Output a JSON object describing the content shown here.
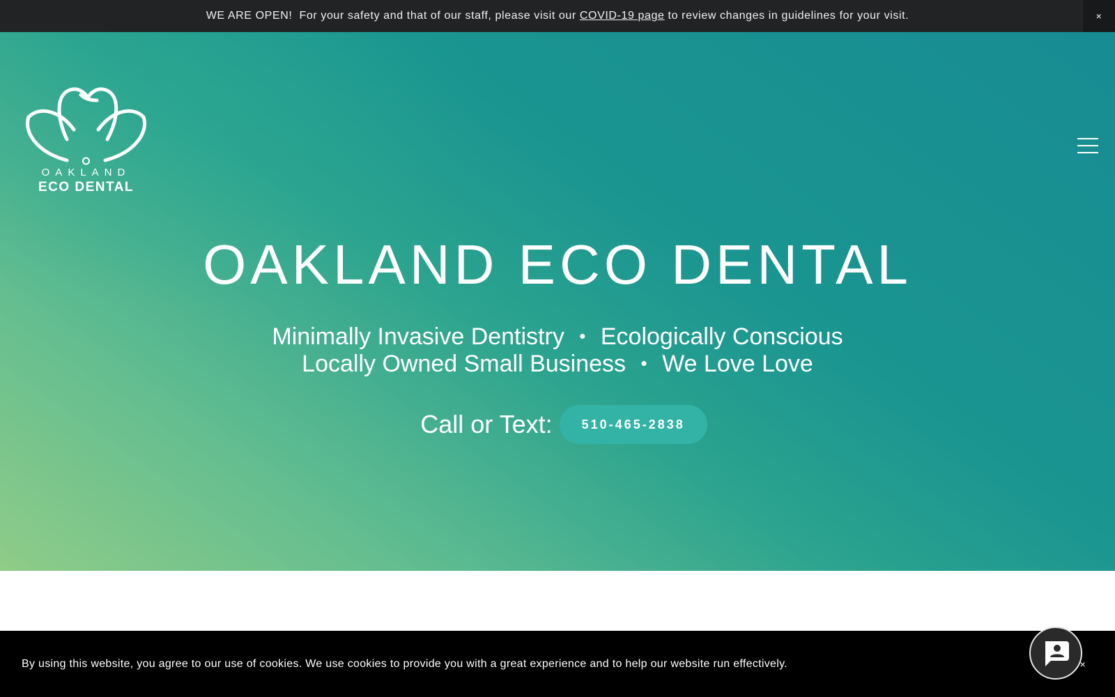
{
  "announcement": {
    "text_before": "WE ARE OPEN!  For your safety and that of our staff, please visit our ",
    "link_text": "COVID-19 page",
    "text_after": " to review changes in guidelines for your visit.",
    "close_label": "×"
  },
  "logo": {
    "line1": "OAKLAND",
    "line2": "ECO DENTAL",
    "icon": "tooth-flower-logo-icon"
  },
  "nav": {
    "menu_icon": "hamburger-menu-icon"
  },
  "hero": {
    "title": "OAKLAND ECO DENTAL",
    "taglines": [
      [
        "Minimally Invasive Dentistry",
        "Ecologically Conscious"
      ],
      [
        "Locally Owned Small Business",
        "We Love Love"
      ]
    ],
    "separator": "•",
    "call_label": "Call or Text:",
    "phone": "510-465-2838"
  },
  "cookie": {
    "text": "By using this website, you agree to our use of cookies. We use cookies to provide you with a great experience and to help our website run effectively.",
    "close_label": "×"
  },
  "chat": {
    "icon": "chat-person-icon"
  },
  "colors": {
    "announce_bg": "#222324",
    "hero_gradient_start": "#8fcc88",
    "hero_gradient_end": "#178c93",
    "phone_button": "#33b3a5",
    "cookie_bg": "#000000"
  }
}
